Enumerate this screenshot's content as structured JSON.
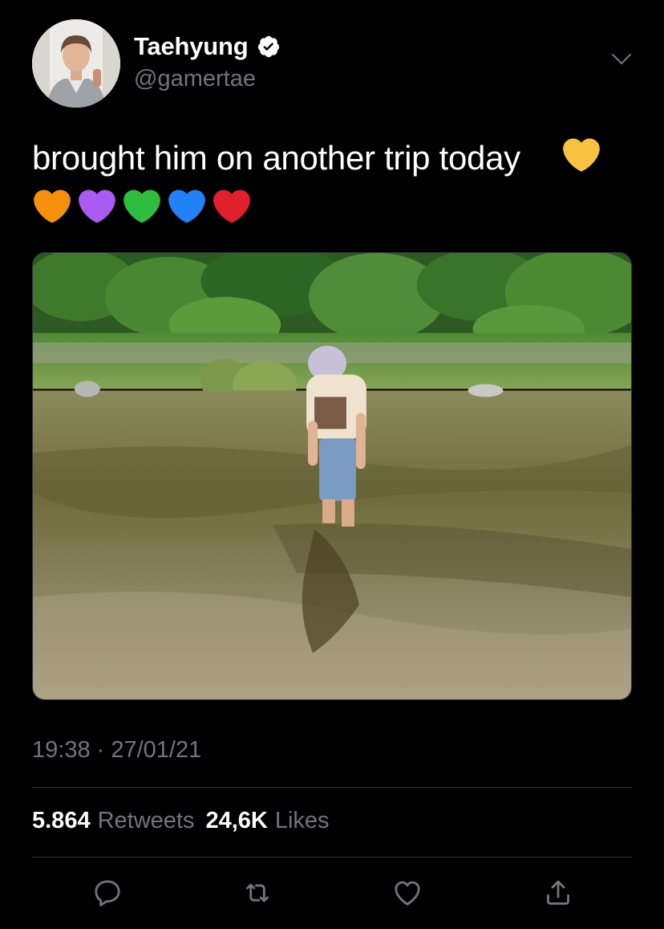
{
  "user": {
    "display_name": "Taehyung",
    "handle": "@gamertae",
    "verified": true
  },
  "tweet": {
    "text": "brought him on another trip today",
    "hearts": [
      "yellow-heart",
      "orange-heart",
      "purple-heart",
      "green-heart",
      "blue-heart",
      "red-heart"
    ],
    "timestamp": "19:38 · 27/01/21"
  },
  "stats": {
    "retweets_count": "5.864",
    "retweets_label": "Retweets",
    "likes_count": "24,6K",
    "likes_label": "Likes"
  },
  "actions": [
    "reply-icon",
    "retweet-icon",
    "like-icon",
    "share-icon"
  ],
  "colors": {
    "background": "#000000",
    "secondary_text": "#6e767d",
    "divider": "#2f3336",
    "yellow_heart": "#f6c240",
    "orange_heart": "#f4900c",
    "purple_heart": "#aa5cf2",
    "green_heart": "#2ebd3f",
    "blue_heart": "#2281f4",
    "red_heart": "#e0202b"
  }
}
